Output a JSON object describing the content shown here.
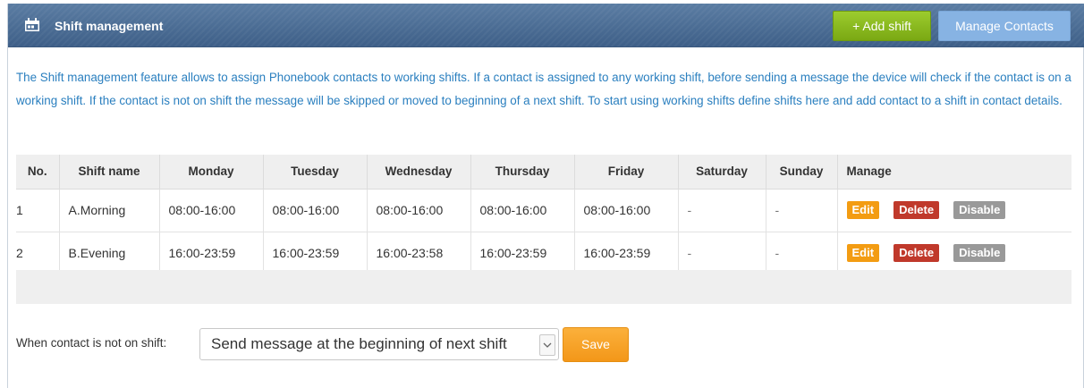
{
  "header": {
    "title": "Shift management",
    "add_shift_label": "+ Add shift",
    "manage_contacts_label": "Manage Contacts"
  },
  "info_text": "The Shift management feature allows to assign Phonebook contacts to working shifts. If a contact is assigned to any working shift, before sending a message the device will check if the contact is on a working shift. If the contact is not on shift the message will be skipped or moved to beginning of a next shift. To start using working shifts define shifts here and add contact to a shift in contact details.",
  "table": {
    "columns": [
      "No.",
      "Shift name",
      "Monday",
      "Tuesday",
      "Wednesday",
      "Thursday",
      "Friday",
      "Saturday",
      "Sunday",
      "Manage"
    ],
    "rows": [
      [
        "1",
        "A.Morning",
        "08:00-16:00",
        "08:00-16:00",
        "08:00-16:00",
        "08:00-16:00",
        "08:00-16:00",
        "-",
        "-"
      ],
      [
        "2",
        "B.Evening",
        "16:00-23:59",
        "16:00-23:59",
        "16:00-23:58",
        "16:00-23:59",
        "16:00-23:59",
        "-",
        "-"
      ]
    ],
    "actions": {
      "edit": "Edit",
      "delete": "Delete",
      "disable": "Disable"
    }
  },
  "controls": {
    "label": "When contact is not on shift:",
    "selected_option": "Send message at the beginning of next shift",
    "save_label": "Save"
  },
  "colors": {
    "header_bg": "#4a6c95",
    "add_button": "#8bbd20",
    "manage_button": "#87b3e3",
    "info_text": "#2a7fbf",
    "edit": "#f39c12",
    "delete": "#c0392b",
    "disable": "#999999",
    "save": "#f7a12a"
  },
  "icons": {
    "header": "calendar-icon",
    "dropdown": "chevron-down-icon"
  }
}
